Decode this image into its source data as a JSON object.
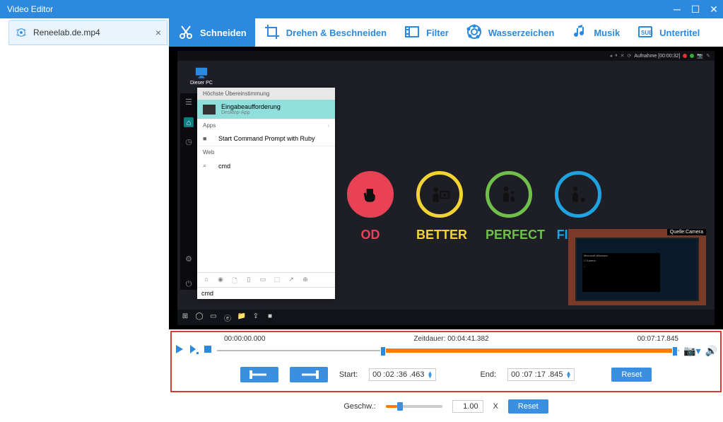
{
  "title": "Video Editor",
  "file_tab": "Reneelab.de.mp4",
  "tools": {
    "cut": "Schneiden",
    "rotate": "Drehen & Beschneiden",
    "filter": "Filter",
    "watermark": "Wasserzeichen",
    "music": "Musik",
    "subtitle": "Untertitel"
  },
  "preview": {
    "rec_label": "Aufnahme [00:00:32]",
    "pc_label": "Dieser PC",
    "search": {
      "header": "Höchste Übereinstimmung",
      "top_title": "Eingabeaufforderung",
      "top_sub": "Desktop-App",
      "cat_apps": "Apps",
      "app1": "Start Command Prompt with Ruby",
      "cat_web": "Web",
      "web1": "cmd",
      "input_value": "cmd"
    },
    "labels": {
      "l1": "OD",
      "l2": "BETTER",
      "l3": "PERFECT",
      "l4": "FINE TOO"
    },
    "cam_label": "Quelle:Camera"
  },
  "timeline": {
    "t_start": "00:00:00.000",
    "t_dur_label": "Zeitdauer:",
    "t_dur": "00:04:41.382",
    "t_end": "00:07:17.845",
    "sel_left_pct": 36,
    "sel_right_pct": 99,
    "start_label": "Start:",
    "start_value": "00 :02 :36 .463",
    "end_label": "End:",
    "end_value": "00 :07 :17 .845",
    "reset": "Reset"
  },
  "speed": {
    "label": "Geschw.:",
    "value": "1.00",
    "suffix": "X",
    "reset": "Reset"
  }
}
